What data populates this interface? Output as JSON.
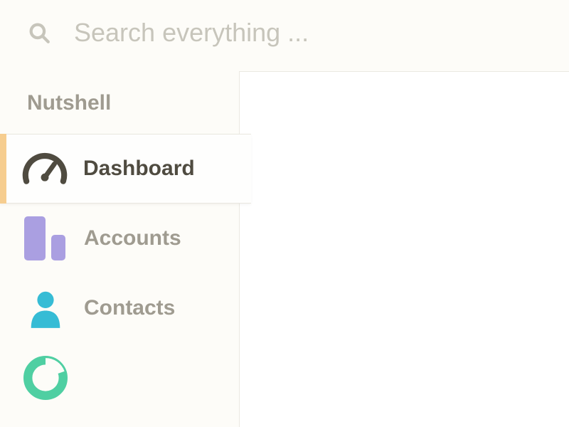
{
  "search": {
    "placeholder": "Search everything ..."
  },
  "brand": "Nutshell",
  "sidebar": {
    "items": [
      {
        "label": "Dashboard"
      },
      {
        "label": "Accounts"
      },
      {
        "label": "Contacts"
      }
    ]
  },
  "colors": {
    "accent_active_bar": "#f6cd8f",
    "icon_accounts": "#aa9fe1",
    "icon_contacts": "#36bcd5",
    "icon_pipeline": "#4fcfa2",
    "text_muted": "#9f9b90",
    "text_strong": "#4f4b40"
  }
}
